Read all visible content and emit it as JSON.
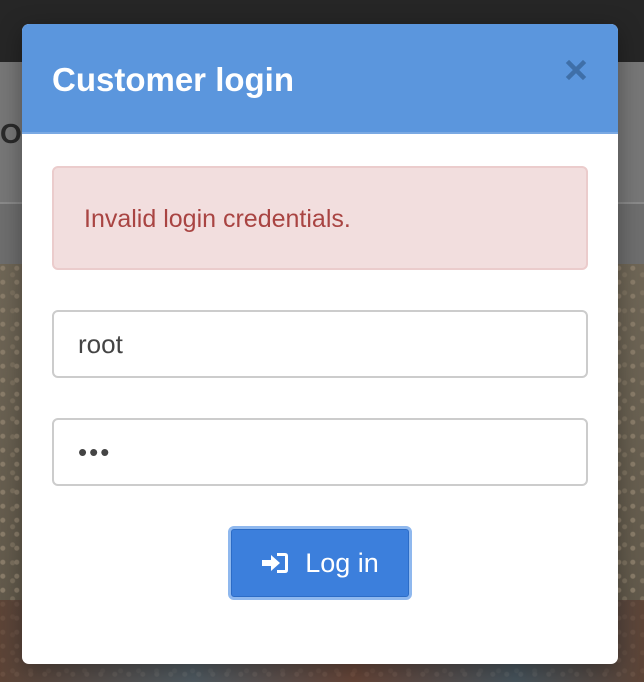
{
  "background": {
    "header_text": "OG"
  },
  "modal": {
    "title": "Customer login",
    "close_icon": "close-icon",
    "alert": {
      "message": "Invalid login credentials.",
      "color": "#a94442",
      "background": "#f2dede"
    },
    "username": {
      "value": "root",
      "placeholder": ""
    },
    "password": {
      "value": "•••",
      "placeholder": ""
    },
    "submit": {
      "label": "Log in",
      "icon": "sign-in-icon"
    },
    "colors": {
      "header": "#5b96dd",
      "button": "#3c7fdc"
    }
  }
}
